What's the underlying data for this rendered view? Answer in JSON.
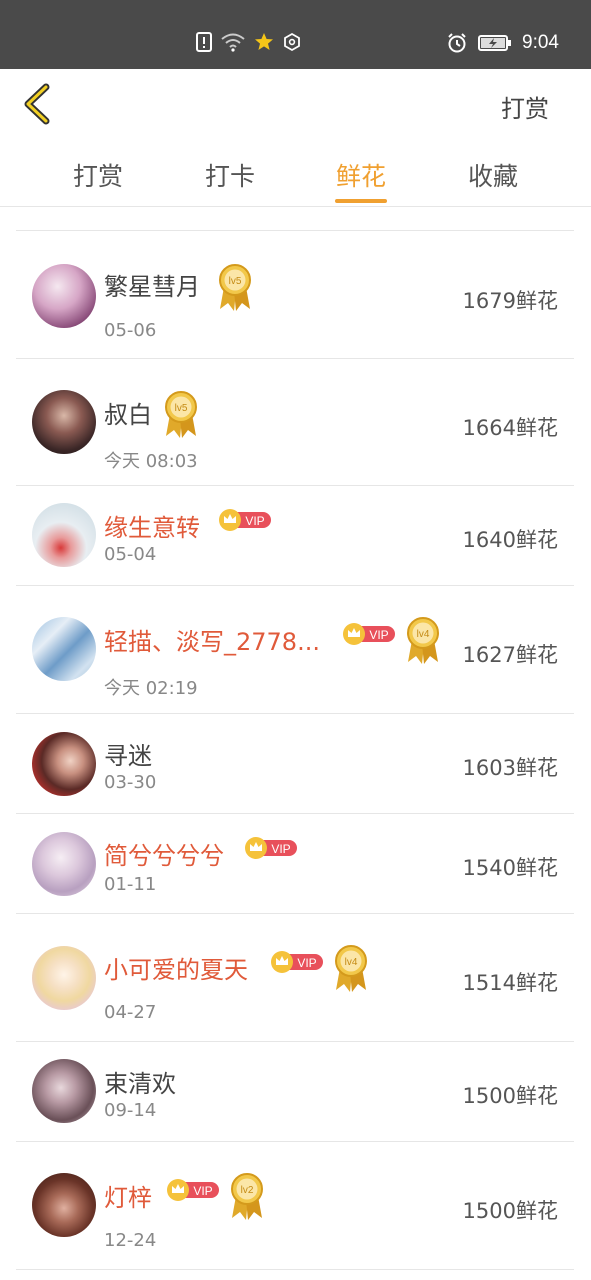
{
  "status_bar": {
    "time": "9:04"
  },
  "header": {
    "action_label": "打赏"
  },
  "tabs": [
    {
      "label": "打赏"
    },
    {
      "label": "打卡"
    },
    {
      "label": "鲜花"
    },
    {
      "label": "收藏"
    }
  ],
  "active_tab": 2,
  "badges": {
    "vip_text": "VIP"
  },
  "rows": [
    {
      "name": "繁星彗月",
      "date": "05-06",
      "amount": "1679鲜花",
      "vip": false,
      "level": "lv5"
    },
    {
      "name": "叔白",
      "date": "今天 08:03",
      "amount": "1664鲜花",
      "vip": false,
      "level": "lv5"
    },
    {
      "name": "缘生意转",
      "date": "05-04",
      "amount": "1640鲜花",
      "vip": true,
      "level": ""
    },
    {
      "name": "轻描、淡写_2778...",
      "date": "今天 02:19",
      "amount": "1627鲜花",
      "vip": true,
      "level": "lv4"
    },
    {
      "name": "寻迷",
      "date": "03-30",
      "amount": "1603鲜花",
      "vip": false,
      "level": ""
    },
    {
      "name": "简兮兮兮兮",
      "date": "01-11",
      "amount": "1540鲜花",
      "vip": true,
      "level": ""
    },
    {
      "name": "小可爱的夏天",
      "date": "04-27",
      "amount": "1514鲜花",
      "vip": true,
      "level": "lv4"
    },
    {
      "name": "束清欢",
      "date": "09-14",
      "amount": "1500鲜花",
      "vip": false,
      "level": ""
    },
    {
      "name": "灯梓",
      "date": "12-24",
      "amount": "1500鲜花",
      "vip": true,
      "level": "lv2"
    }
  ],
  "colors": {
    "accent": "#f0a030",
    "vip_name": "#e05a3a",
    "status_bar": "#4a4a4a"
  }
}
